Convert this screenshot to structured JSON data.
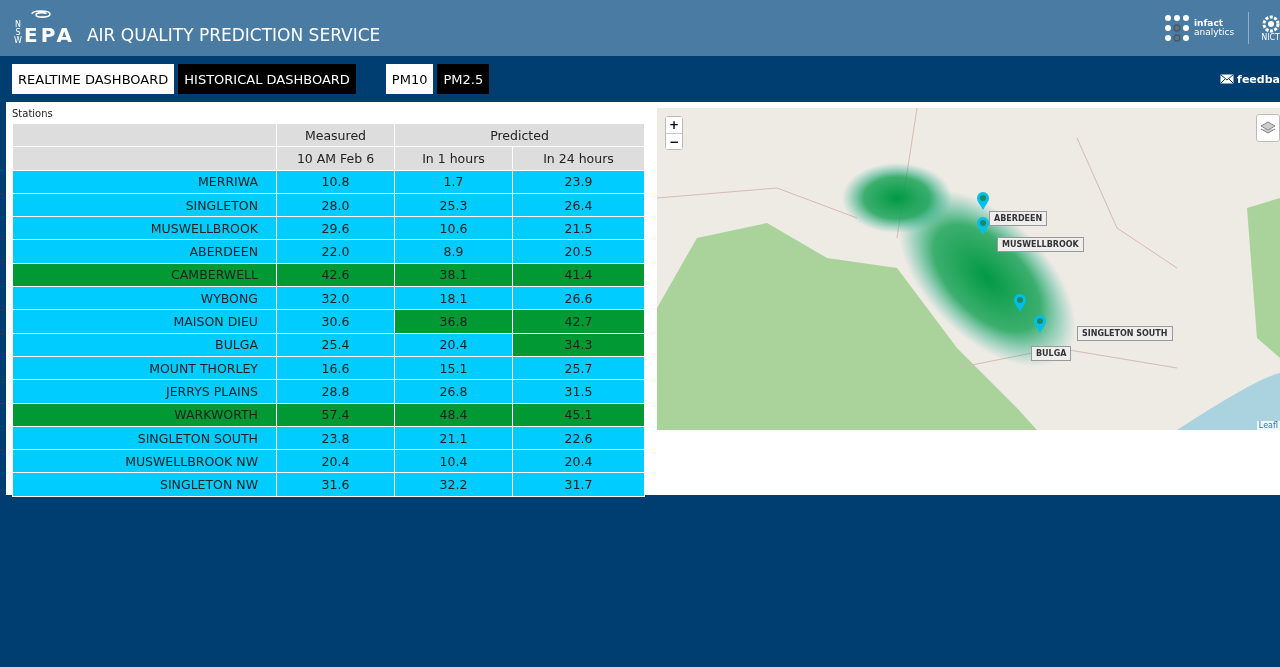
{
  "header": {
    "logo_subtext": "NSW",
    "logo_text": "EPA",
    "title": "AIR QUALITY PREDICTION SERVICE",
    "partner_logo": {
      "line_1": "infact",
      "line_2": "analytics"
    },
    "second_logo": "NICT"
  },
  "nav": {
    "dashboards": [
      {
        "label": "REALTIME DASHBOARD",
        "selected": true
      },
      {
        "label": "HISTORICAL DASHBOARD",
        "selected": false
      }
    ],
    "pollutants": [
      {
        "label": "PM10",
        "selected": true
      },
      {
        "label": "PM2.5",
        "selected": false
      }
    ],
    "feedback": "feedba"
  },
  "table": {
    "title": "Stations",
    "groups": [
      "Measured",
      "Predicted"
    ],
    "columns": [
      "10 AM Feb 6",
      "In 1 hours",
      "In 24 hours"
    ],
    "rows": [
      {
        "station": {
          "text": "MERRIWA",
          "color": "#00ccff"
        },
        "values": [
          {
            "text": "10.8",
            "color": "#00ccff"
          },
          {
            "text": "1.7",
            "color": "#00ccff"
          },
          {
            "text": "23.9",
            "color": "#00ccff"
          }
        ]
      },
      {
        "station": {
          "text": "SINGLETON",
          "color": "#00ccff"
        },
        "values": [
          {
            "text": "28.0",
            "color": "#00ccff"
          },
          {
            "text": "25.3",
            "color": "#00ccff"
          },
          {
            "text": "26.4",
            "color": "#00ccff"
          }
        ]
      },
      {
        "station": {
          "text": "MUSWELLBROOK",
          "color": "#00ccff"
        },
        "values": [
          {
            "text": "29.6",
            "color": "#00ccff"
          },
          {
            "text": "10.6",
            "color": "#00ccff"
          },
          {
            "text": "21.5",
            "color": "#00ccff"
          }
        ]
      },
      {
        "station": {
          "text": "ABERDEEN",
          "color": "#00ccff"
        },
        "values": [
          {
            "text": "22.0",
            "color": "#00ccff"
          },
          {
            "text": "8.9",
            "color": "#00ccff"
          },
          {
            "text": "20.5",
            "color": "#00ccff"
          }
        ]
      },
      {
        "station": {
          "text": "CAMBERWELL",
          "color": "#009933"
        },
        "values": [
          {
            "text": "42.6",
            "color": "#009933"
          },
          {
            "text": "38.1",
            "color": "#009933"
          },
          {
            "text": "41.4",
            "color": "#009933"
          }
        ]
      },
      {
        "station": {
          "text": "WYBONG",
          "color": "#00ccff"
        },
        "values": [
          {
            "text": "32.0",
            "color": "#00ccff"
          },
          {
            "text": "18.1",
            "color": "#00ccff"
          },
          {
            "text": "26.6",
            "color": "#00ccff"
          }
        ]
      },
      {
        "station": {
          "text": "MAISON DIEU",
          "color": "#00ccff"
        },
        "values": [
          {
            "text": "30.6",
            "color": "#00ccff"
          },
          {
            "text": "36.8",
            "color": "#009933"
          },
          {
            "text": "42.7",
            "color": "#009933"
          }
        ]
      },
      {
        "station": {
          "text": "BULGA",
          "color": "#00ccff"
        },
        "values": [
          {
            "text": "25.4",
            "color": "#00ccff"
          },
          {
            "text": "20.4",
            "color": "#00ccff"
          },
          {
            "text": "34.3",
            "color": "#009933"
          }
        ]
      },
      {
        "station": {
          "text": "MOUNT THORLEY",
          "color": "#00ccff"
        },
        "values": [
          {
            "text": "16.6",
            "color": "#00ccff"
          },
          {
            "text": "15.1",
            "color": "#00ccff"
          },
          {
            "text": "25.7",
            "color": "#00ccff"
          }
        ]
      },
      {
        "station": {
          "text": "JERRYS PLAINS",
          "color": "#00ccff"
        },
        "values": [
          {
            "text": "28.8",
            "color": "#00ccff"
          },
          {
            "text": "26.8",
            "color": "#00ccff"
          },
          {
            "text": "31.5",
            "color": "#00ccff"
          }
        ]
      },
      {
        "station": {
          "text": "WARKWORTH",
          "color": "#009933"
        },
        "values": [
          {
            "text": "57.4",
            "color": "#009933"
          },
          {
            "text": "48.4",
            "color": "#009933"
          },
          {
            "text": "45.1",
            "color": "#009933"
          }
        ]
      },
      {
        "station": {
          "text": "SINGLETON SOUTH",
          "color": "#00ccff"
        },
        "values": [
          {
            "text": "23.8",
            "color": "#00ccff"
          },
          {
            "text": "21.1",
            "color": "#00ccff"
          },
          {
            "text": "22.6",
            "color": "#00ccff"
          }
        ]
      },
      {
        "station": {
          "text": "MUSWELLBROOK NW",
          "color": "#00ccff"
        },
        "values": [
          {
            "text": "20.4",
            "color": "#00ccff"
          },
          {
            "text": "10.4",
            "color": "#00ccff"
          },
          {
            "text": "20.4",
            "color": "#00ccff"
          }
        ]
      },
      {
        "station": {
          "text": "SINGLETON NW",
          "color": "#00ccff"
        },
        "values": [
          {
            "text": "31.6",
            "color": "#00ccff"
          },
          {
            "text": "32.2",
            "color": "#00ccff"
          },
          {
            "text": "31.7",
            "color": "#00ccff"
          }
        ]
      }
    ]
  },
  "map": {
    "zoom_in": "+",
    "zoom_out": "−",
    "attribution": "Leafl",
    "markers": [
      {
        "label": "ABERDEEN"
      },
      {
        "label": "MUSWELLBROOK"
      },
      {
        "label": "SINGLETON SOUTH"
      },
      {
        "label": "BULGA"
      }
    ]
  }
}
